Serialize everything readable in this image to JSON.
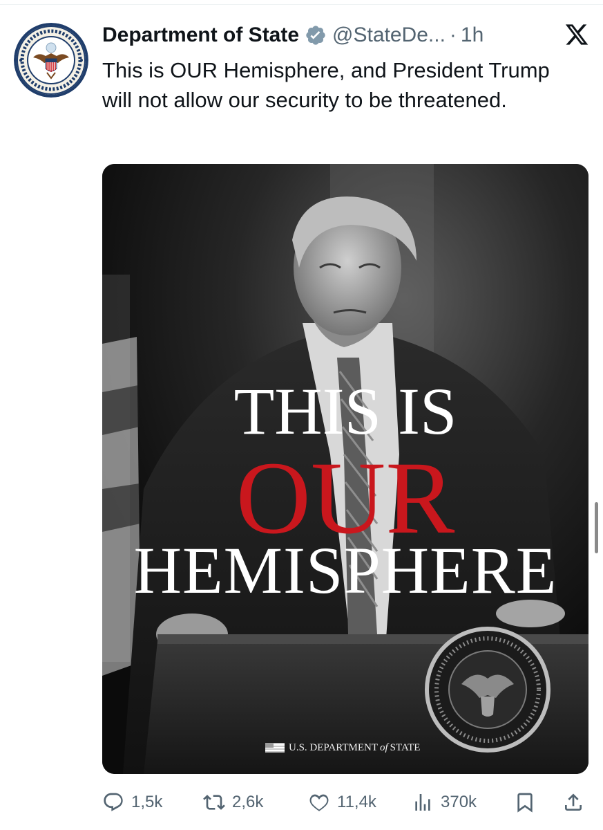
{
  "tweet": {
    "author": {
      "display_name": "Department of State",
      "handle": "@StateDe...",
      "avatar_icon": "department-of-state-seal",
      "verified": true,
      "seal_text": "DEPARTMENT OF STATE · UNITED STATES OF AMERICA"
    },
    "separator": "·",
    "time": "1h",
    "platform_icon": "x-logo",
    "text": "This is OUR Hemisphere, and President Trump will not allow our security to be threatened.",
    "media": {
      "headline_line1": "THIS IS",
      "headline_line2": "OUR",
      "headline_line3": "HEMISPHERE",
      "credit_pre": "U.S. DEPARTMENT",
      "credit_of": "of",
      "credit_post": "STATE",
      "colors": {
        "headline_accent": "#c9171d",
        "headline": "#ffffff",
        "background": "#111111"
      }
    },
    "actions": {
      "replies": "1,5k",
      "reposts": "2,6k",
      "likes": "11,4k",
      "views": "370k",
      "bookmark_icon": "bookmark-icon",
      "share_icon": "share-icon"
    }
  }
}
